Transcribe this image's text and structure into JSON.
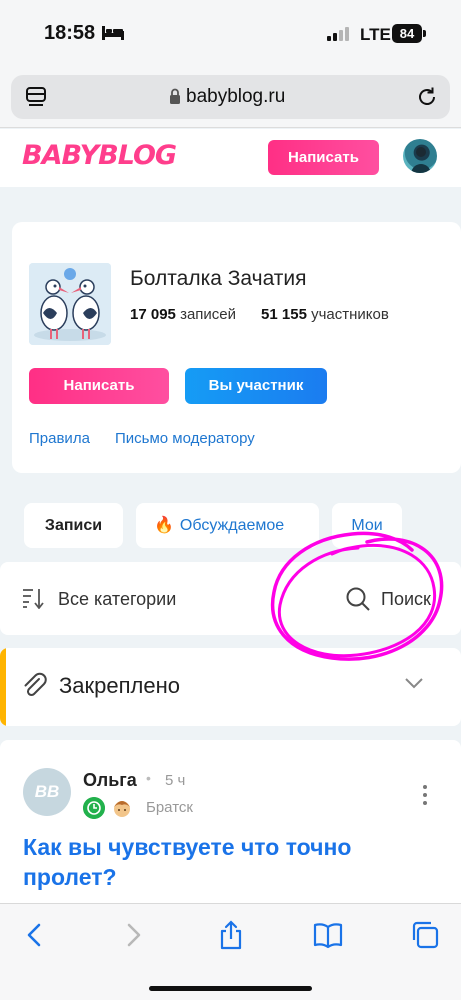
{
  "status_bar": {
    "time": "18:58",
    "network": "LTE",
    "battery": "84"
  },
  "browser": {
    "url": "babyblog.ru"
  },
  "site_header": {
    "logo": "BABYBLOG",
    "write_button": "Написать"
  },
  "community": {
    "title": "Болталка Зачатия",
    "records_count": "17 095",
    "records_label": "записей",
    "members_count": "51 155",
    "members_label": "участников",
    "write_button": "Написать",
    "member_button": "Вы участник",
    "rules_link": "Правила",
    "moderator_link": "Письмо модератору"
  },
  "tabs": [
    {
      "label": "Записи"
    },
    {
      "label": "Обсуждаемое",
      "emoji": "🔥"
    },
    {
      "label": "Мои"
    }
  ],
  "filter": {
    "categories_label": "Все категории",
    "search_label": "Поиск"
  },
  "pinned": {
    "label": "Закреплено"
  },
  "post": {
    "avatar_initials": "ВВ",
    "author": "Ольга",
    "separator": "•",
    "time": "5 ч",
    "city": "Братск",
    "title": "Как вы чувствуете что точно пролет?"
  },
  "colors": {
    "brand_pink": "#ff3e8c",
    "link_blue": "#1f77d0",
    "member_blue": "#1b7cf0",
    "pinned_accent": "#ffb400",
    "annotation_magenta": "#ff00e6"
  }
}
